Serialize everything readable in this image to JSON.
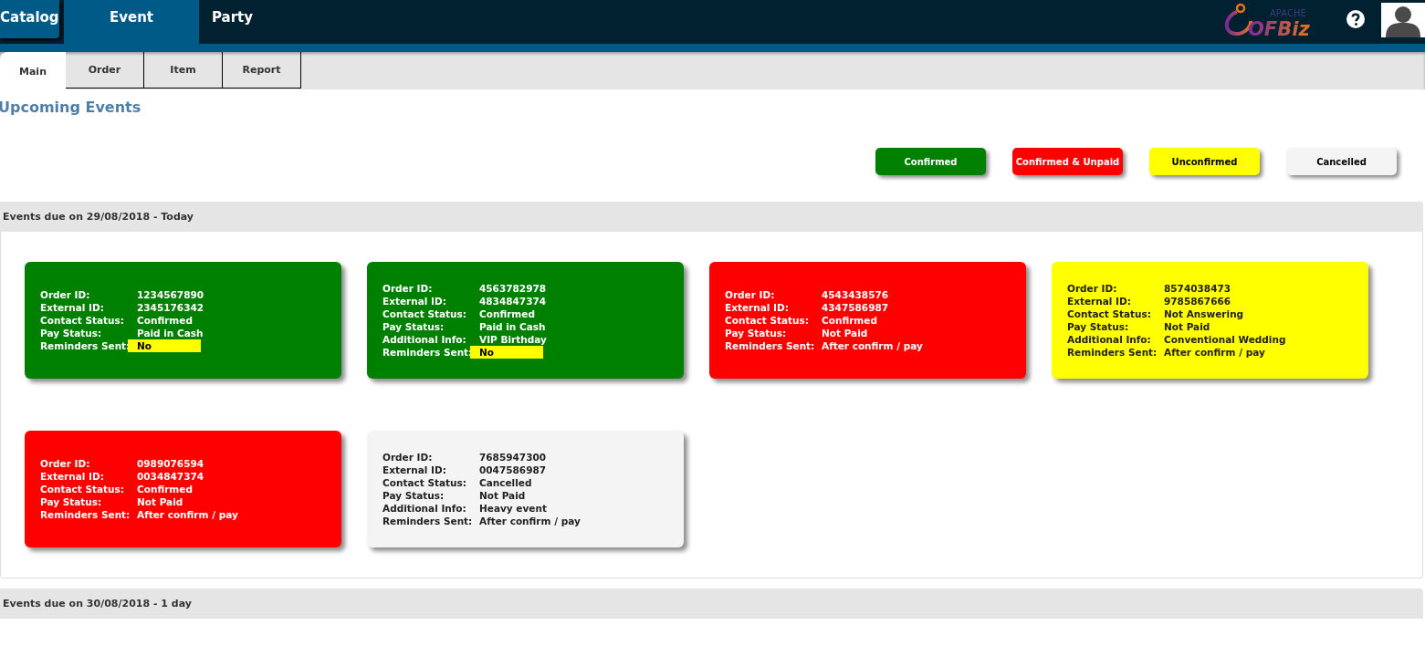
{
  "main_tabs": [
    {
      "label": "Catalog",
      "selected": false
    },
    {
      "label": "Event",
      "selected": true
    },
    {
      "label": "Party",
      "selected": false
    }
  ],
  "logo": {
    "prefix": "APACHE",
    "name": "OFBiz"
  },
  "sub_tabs": [
    {
      "label": "Main",
      "selected": true
    },
    {
      "label": "Order",
      "selected": false
    },
    {
      "label": "Item",
      "selected": false
    },
    {
      "label": "Report",
      "selected": false
    }
  ],
  "page_title": "Upcoming Events",
  "legend": [
    {
      "label": "Confirmed",
      "color": "#008000"
    },
    {
      "label": "Confirmed & Unpaid",
      "color": "#ff0000"
    },
    {
      "label": "Unconfirmed",
      "color": "#ffff00"
    },
    {
      "label": "Cancelled",
      "color": "#f4f4f4"
    }
  ],
  "sections": [
    {
      "title": "Events due on 29/08/2018 - Today",
      "events": [
        {
          "color": "#008000",
          "fields": [
            {
              "label": "Order ID:",
              "value": "1234567890",
              "highlighted": false
            },
            {
              "label": "External ID:",
              "value": "2345176342",
              "highlighted": false
            },
            {
              "label": "Contact Status:",
              "value": "Confirmed",
              "highlighted": false
            },
            {
              "label": "Pay Status:",
              "value": "Paid in Cash",
              "highlighted": false
            },
            {
              "label": "Reminders Sent:",
              "value": "No",
              "highlighted": true
            }
          ]
        },
        {
          "color": "#008000",
          "fields": [
            {
              "label": "Order ID:",
              "value": "4563782978",
              "highlighted": false
            },
            {
              "label": "External ID:",
              "value": "4834847374",
              "highlighted": false
            },
            {
              "label": "Contact Status:",
              "value": "Confirmed",
              "highlighted": false
            },
            {
              "label": "Pay Status:",
              "value": "Paid in Cash",
              "highlighted": false
            },
            {
              "label": "Additional Info:",
              "value": "VIP Birthday",
              "highlighted": false
            },
            {
              "label": "Reminders Sent:",
              "value": "No",
              "highlighted": true
            }
          ]
        },
        {
          "color": "#ff0000",
          "fields": [
            {
              "label": "Order ID:",
              "value": "4543438576",
              "highlighted": false
            },
            {
              "label": "External ID:",
              "value": "4347586987",
              "highlighted": false
            },
            {
              "label": "Contact Status:",
              "value": "Confirmed",
              "highlighted": false
            },
            {
              "label": "Pay Status:",
              "value": "Not Paid",
              "highlighted": false
            },
            {
              "label": "Reminders Sent:",
              "value": "After confirm / pay",
              "highlighted": false
            }
          ]
        },
        {
          "color": "#ffff00",
          "fields": [
            {
              "label": "Order ID:",
              "value": "8574038473",
              "highlighted": false
            },
            {
              "label": "External ID:",
              "value": "9785867666",
              "highlighted": false
            },
            {
              "label": "Contact Status:",
              "value": "Not Answering",
              "highlighted": false
            },
            {
              "label": "Pay Status:",
              "value": "Not Paid",
              "highlighted": false
            },
            {
              "label": "Additional Info:",
              "value": "Conventional Wedding",
              "highlighted": false
            },
            {
              "label": "Reminders Sent:",
              "value": "After confirm / pay",
              "highlighted": false
            }
          ]
        },
        {
          "color": "#ff0000",
          "fields": [
            {
              "label": "Order ID:",
              "value": "0989076594",
              "highlighted": false
            },
            {
              "label": "External ID:",
              "value": "0034847374",
              "highlighted": false
            },
            {
              "label": "Contact Status:",
              "value": "Confirmed",
              "highlighted": false
            },
            {
              "label": "Pay Status:",
              "value": "Not Paid",
              "highlighted": false
            },
            {
              "label": "Reminders Sent:",
              "value": "After confirm / pay",
              "highlighted": false
            }
          ]
        },
        {
          "color": "#f4f4f4",
          "fields": [
            {
              "label": "Order ID:",
              "value": "7685947300",
              "highlighted": false
            },
            {
              "label": "External ID:",
              "value": "0047586987",
              "highlighted": false
            },
            {
              "label": "Contact Status:",
              "value": "Cancelled",
              "highlighted": false
            },
            {
              "label": "Pay Status:",
              "value": "Not Paid",
              "highlighted": false
            },
            {
              "label": "Additional Info:",
              "value": "Heavy event",
              "highlighted": false
            },
            {
              "label": "Reminders Sent:",
              "value": "After confirm / pay",
              "highlighted": false
            }
          ]
        }
      ]
    },
    {
      "title": "Events due on 30/08/2018 - 1 day"
    }
  ]
}
